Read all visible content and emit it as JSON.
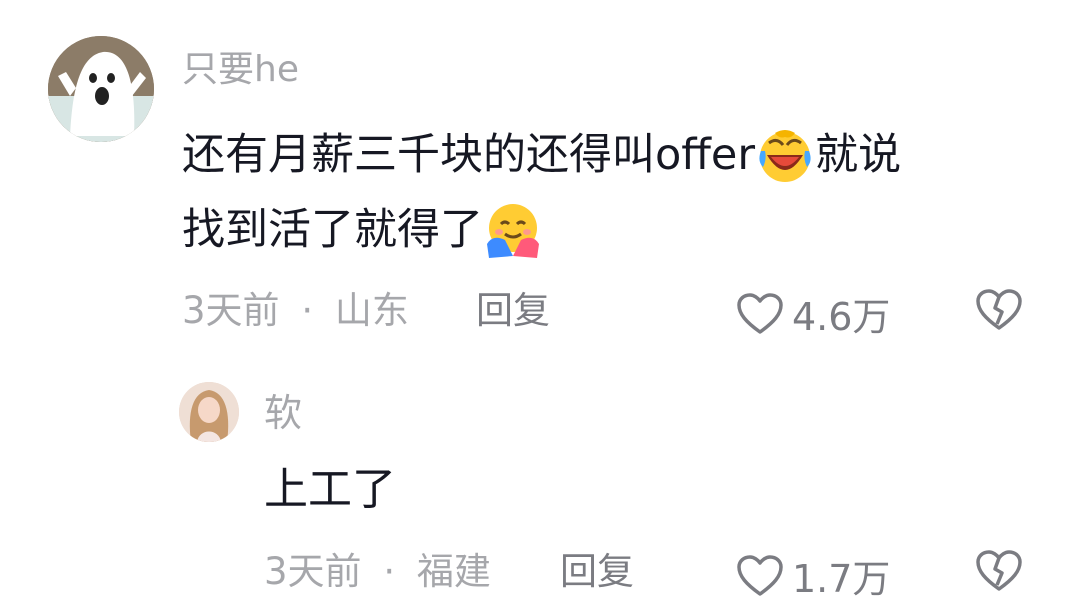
{
  "comment": {
    "username": "只要he",
    "line1_text": "还有月薪三千块的还得叫offer",
    "line1_tail": "就说",
    "line2_text": "找到活了就得了",
    "time": "3天前",
    "separator": "·",
    "location": "山东",
    "reply_label": "回复",
    "likes": "4.6万",
    "emoji1": "laughing-crying-emoji",
    "emoji2": "hugging-face-emoji"
  },
  "reply": {
    "username": "软",
    "text": "上工了",
    "time": "3天前",
    "separator": "·",
    "location": "福建",
    "reply_label": "回复",
    "likes": "1.7万"
  },
  "colors": {
    "text_primary": "#161823",
    "text_secondary": "#a6a7ab",
    "text_action": "#7b7c82"
  }
}
